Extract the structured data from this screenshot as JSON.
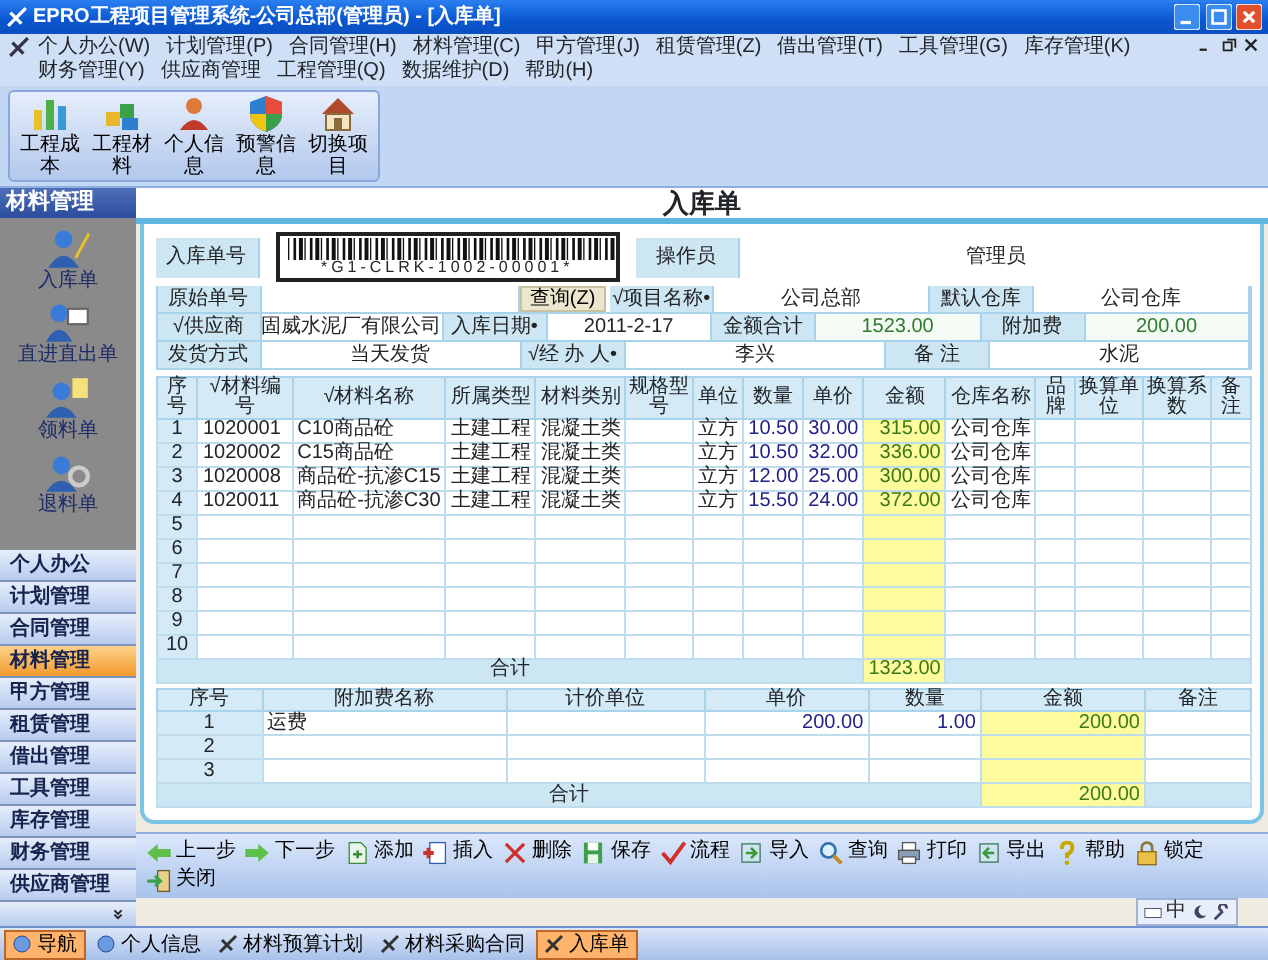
{
  "window": {
    "title": "EPRO工程项目管理系统-公司总部(管理员) - [入库单]"
  },
  "menu": [
    "个人办公(W)",
    "计划管理(P)",
    "合同管理(H)",
    "材料管理(C)",
    "甲方管理(J)",
    "租赁管理(Z)",
    "借出管理(T)",
    "工具管理(G)",
    "库存管理(K)",
    "财务管理(Y)",
    "供应商管理",
    "工程管理(Q)",
    "数据维护(D)",
    "帮助(H)"
  ],
  "toolbar": [
    {
      "label": "工程成本",
      "kind": "chart"
    },
    {
      "label": "工程材料",
      "kind": "blocks"
    },
    {
      "label": "个人信息",
      "kind": "person"
    },
    {
      "label": "预警信息",
      "kind": "shield"
    },
    {
      "label": "切换项目",
      "kind": "home"
    }
  ],
  "sidebar": {
    "title": "材料管理",
    "shortcuts": [
      {
        "label": "入库单",
        "kind": "pen"
      },
      {
        "label": "直进直出单",
        "kind": "card"
      },
      {
        "label": "领料单",
        "kind": "note"
      },
      {
        "label": "退料单",
        "kind": "gear"
      }
    ],
    "nav": [
      {
        "label": "个人办公",
        "selected": false
      },
      {
        "label": "计划管理",
        "selected": false
      },
      {
        "label": "合同管理",
        "selected": false
      },
      {
        "label": "材料管理",
        "selected": true
      },
      {
        "label": "甲方管理",
        "selected": false
      },
      {
        "label": "租赁管理",
        "selected": false
      },
      {
        "label": "借出管理",
        "selected": false
      },
      {
        "label": "工具管理",
        "selected": false
      },
      {
        "label": "库存管理",
        "selected": false
      },
      {
        "label": "财务管理",
        "selected": false
      },
      {
        "label": "供应商管理",
        "selected": false
      }
    ]
  },
  "document": {
    "title": "入库单",
    "header": [
      [
        {
          "kind": "label",
          "text": "入库单号"
        },
        {
          "kind": "barcode",
          "text": "*G1-CLRK-1002-00001*"
        },
        {
          "kind": "label",
          "text": "操作员"
        },
        {
          "kind": "value",
          "text": "管理员"
        }
      ],
      [
        {
          "kind": "label",
          "text": "原始单号"
        },
        {
          "kind": "blank"
        },
        {
          "kind": "button",
          "text": "查询(Z)"
        },
        {
          "kind": "label",
          "text": "√项目名称•"
        },
        {
          "kind": "value",
          "text": "公司总部"
        },
        {
          "kind": "label",
          "text": "默认仓库"
        },
        {
          "kind": "value",
          "text": "公司仓库"
        }
      ],
      [
        {
          "kind": "label",
          "text": "√供应商"
        },
        {
          "kind": "value",
          "text": "固威水泥厂有限公司"
        },
        {
          "kind": "label",
          "text": "入库日期•"
        },
        {
          "kind": "value",
          "text": "2011-2-17"
        },
        {
          "kind": "label",
          "text": "金额合计"
        },
        {
          "kind": "number",
          "text": "1523.00"
        },
        {
          "kind": "label",
          "text": "附加费"
        },
        {
          "kind": "number",
          "text": "200.00"
        }
      ],
      [
        {
          "kind": "label",
          "text": "发货方式"
        },
        {
          "kind": "value",
          "text": "当天发货"
        },
        {
          "kind": "label",
          "text": "√经 办 人•"
        },
        {
          "kind": "value",
          "text": "李兴"
        },
        {
          "kind": "label",
          "text": "备 注"
        },
        {
          "kind": "value",
          "text": "水泥"
        }
      ]
    ],
    "items_table": {
      "columns": [
        {
          "label": "序号",
          "kind": "index"
        },
        {
          "label": "√材料编号",
          "kind": "text"
        },
        {
          "label": "√材料名称",
          "kind": "text"
        },
        {
          "label": "所属类型",
          "kind": "text"
        },
        {
          "label": "材料类别",
          "kind": "text"
        },
        {
          "label": "规格型号",
          "kind": "text"
        },
        {
          "label": "单位",
          "kind": "center"
        },
        {
          "label": "数量",
          "kind": "number"
        },
        {
          "label": "单价",
          "kind": "number"
        },
        {
          "label": "金额",
          "kind": "amount"
        },
        {
          "label": "仓库名称",
          "kind": "center"
        },
        {
          "label": "品牌",
          "kind": "text"
        },
        {
          "label": "换算单位",
          "kind": "text"
        },
        {
          "label": "换算系数",
          "kind": "text"
        },
        {
          "label": "备注",
          "kind": "text"
        }
      ],
      "rows": [
        {
          "no": "1",
          "cells": [
            "1020001",
            "C10商品砼",
            "土建工程",
            "混凝土类",
            null,
            "立方",
            "10.50",
            "30.00",
            "315.00",
            "公司仓库",
            null,
            null,
            null,
            null
          ]
        },
        {
          "no": "2",
          "cells": [
            "1020002",
            "C15商品砼",
            "土建工程",
            "混凝土类",
            null,
            "立方",
            "10.50",
            "32.00",
            "336.00",
            "公司仓库",
            null,
            null,
            null,
            null
          ]
        },
        {
          "no": "3",
          "cells": [
            "1020008",
            "商品砼-抗渗C15",
            "土建工程",
            "混凝土类",
            null,
            "立方",
            "12.00",
            "25.00",
            "300.00",
            "公司仓库",
            null,
            null,
            null,
            null
          ]
        },
        {
          "no": "4",
          "cells": [
            "1020011",
            "商品砼-抗渗C30",
            "土建工程",
            "混凝土类",
            null,
            "立方",
            "15.50",
            "24.00",
            "372.00",
            "公司仓库",
            null,
            null,
            null,
            null
          ]
        },
        {
          "no": "5"
        },
        {
          "no": "6"
        },
        {
          "no": "7"
        },
        {
          "no": "8"
        },
        {
          "no": "9"
        },
        {
          "no": "10"
        }
      ],
      "total": {
        "label": "合计",
        "amount": "1323.00"
      }
    },
    "fee_table": {
      "columns": [
        {
          "label": "序号",
          "kind": "index"
        },
        {
          "label": "附加费名称",
          "kind": "text"
        },
        {
          "label": "计价单位",
          "kind": "text"
        },
        {
          "label": "单价",
          "kind": "number"
        },
        {
          "label": "数量",
          "kind": "number"
        },
        {
          "label": "金额",
          "kind": "amount"
        },
        {
          "label": "备注",
          "kind": "text"
        }
      ],
      "rows": [
        {
          "no": "1",
          "cells": [
            "运费",
            null,
            "200.00",
            "1.00",
            "200.00",
            null
          ]
        },
        {
          "no": "2"
        },
        {
          "no": "3"
        }
      ],
      "total": {
        "label": "合计",
        "amount": "200.00"
      }
    }
  },
  "actions": [
    {
      "label": "上一步",
      "kind": "prev"
    },
    {
      "label": "下一步",
      "kind": "next"
    },
    {
      "label": "添加",
      "kind": "add"
    },
    {
      "label": "插入",
      "kind": "insert"
    },
    {
      "label": "删除",
      "kind": "delete"
    },
    {
      "label": "保存",
      "kind": "save"
    },
    {
      "label": "流程",
      "kind": "flow"
    },
    {
      "label": "导入",
      "kind": "import"
    },
    {
      "label": "查询",
      "kind": "search"
    },
    {
      "label": "打印",
      "kind": "print"
    },
    {
      "label": "导出",
      "kind": "export"
    },
    {
      "label": "帮助",
      "kind": "help"
    },
    {
      "label": "锁定",
      "kind": "lock"
    },
    {
      "label": "关闭",
      "kind": "close"
    }
  ],
  "ime_bar": {
    "label": "中"
  },
  "panel_tabs": [
    {
      "label": "导航",
      "selected": true
    },
    {
      "label": "个人信息",
      "selected": false
    }
  ],
  "doc_tabs": [
    {
      "label": "材料预算计划",
      "selected": false
    },
    {
      "label": "材料采购合同",
      "selected": false
    },
    {
      "label": "入库单",
      "selected": true
    }
  ]
}
